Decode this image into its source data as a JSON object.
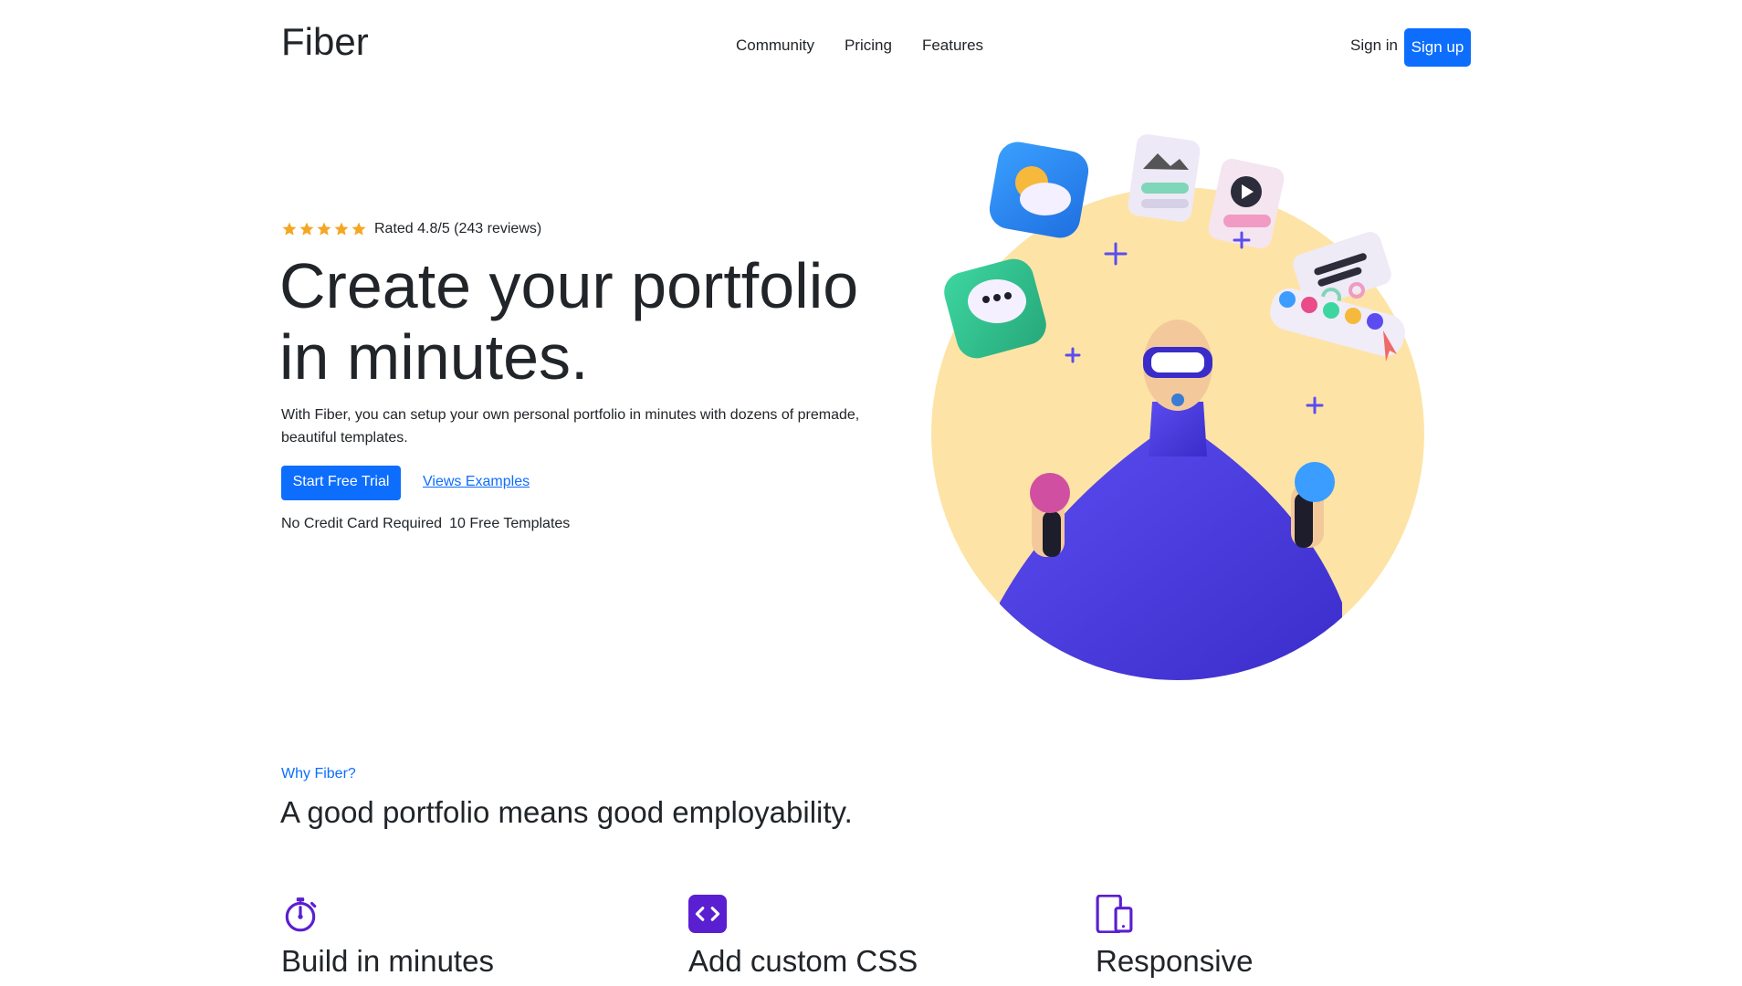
{
  "nav": {
    "brand": "Fiber",
    "links": [
      "Community",
      "Pricing",
      "Features"
    ],
    "sign_in": "Sign in",
    "sign_up": "Sign up"
  },
  "hero": {
    "rating_text": "Rated 4.8/5 (243 reviews)",
    "rating_stars": 5,
    "headline_line1": "Create your portfolio",
    "headline_line2": "in minutes.",
    "lead": "With Fiber, you can setup your own personal portfolio in minutes with dozens of premade, beautiful templates.",
    "cta_primary": "Start Free Trial",
    "cta_secondary": "Views Examples",
    "note1": "No Credit Card Required",
    "note2": "10 Free Templates"
  },
  "why": {
    "eyebrow": "Why Fiber?",
    "title": "A good portfolio means good employability."
  },
  "features": [
    {
      "title": "Build in minutes",
      "icon": "stopwatch-icon"
    },
    {
      "title": "Add custom CSS",
      "icon": "code-icon"
    },
    {
      "title": "Responsive",
      "icon": "devices-icon"
    }
  ],
  "colors": {
    "primary": "#0d6efd",
    "accent_purple": "#5a1fd1",
    "star": "#f5a623",
    "circle_bg": "#fde4a6",
    "figure_blue": "#4a3fe0"
  }
}
